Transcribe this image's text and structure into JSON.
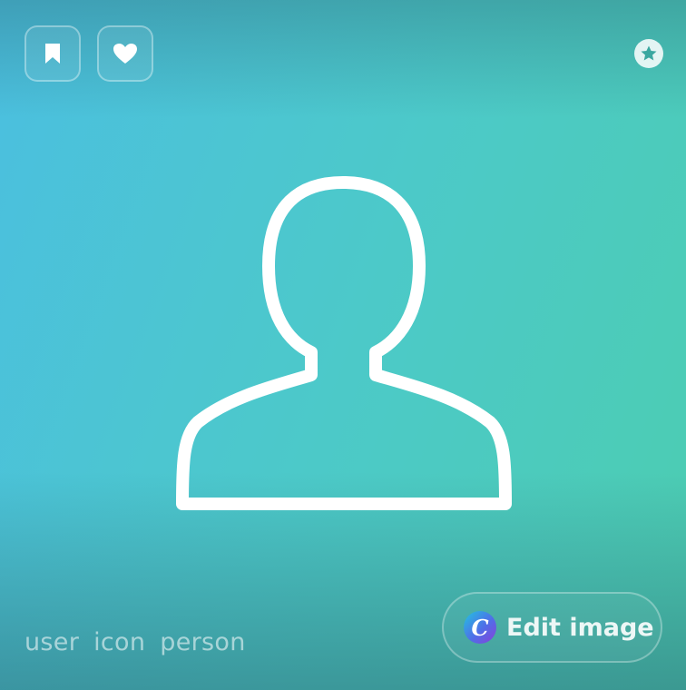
{
  "actions": {
    "save_icon": "bookmark-icon",
    "like_icon": "heart-icon",
    "premium_icon": "star-icon"
  },
  "image": {
    "icon": "user-outline-icon"
  },
  "tags": [
    "user",
    "icon",
    "person"
  ],
  "edit_button": {
    "logo_letter": "C",
    "label": "Edit image"
  },
  "colors": {
    "gradient_start": "#4bbfe0",
    "gradient_end": "#4ccdb0",
    "icon_stroke": "#ffffff"
  }
}
